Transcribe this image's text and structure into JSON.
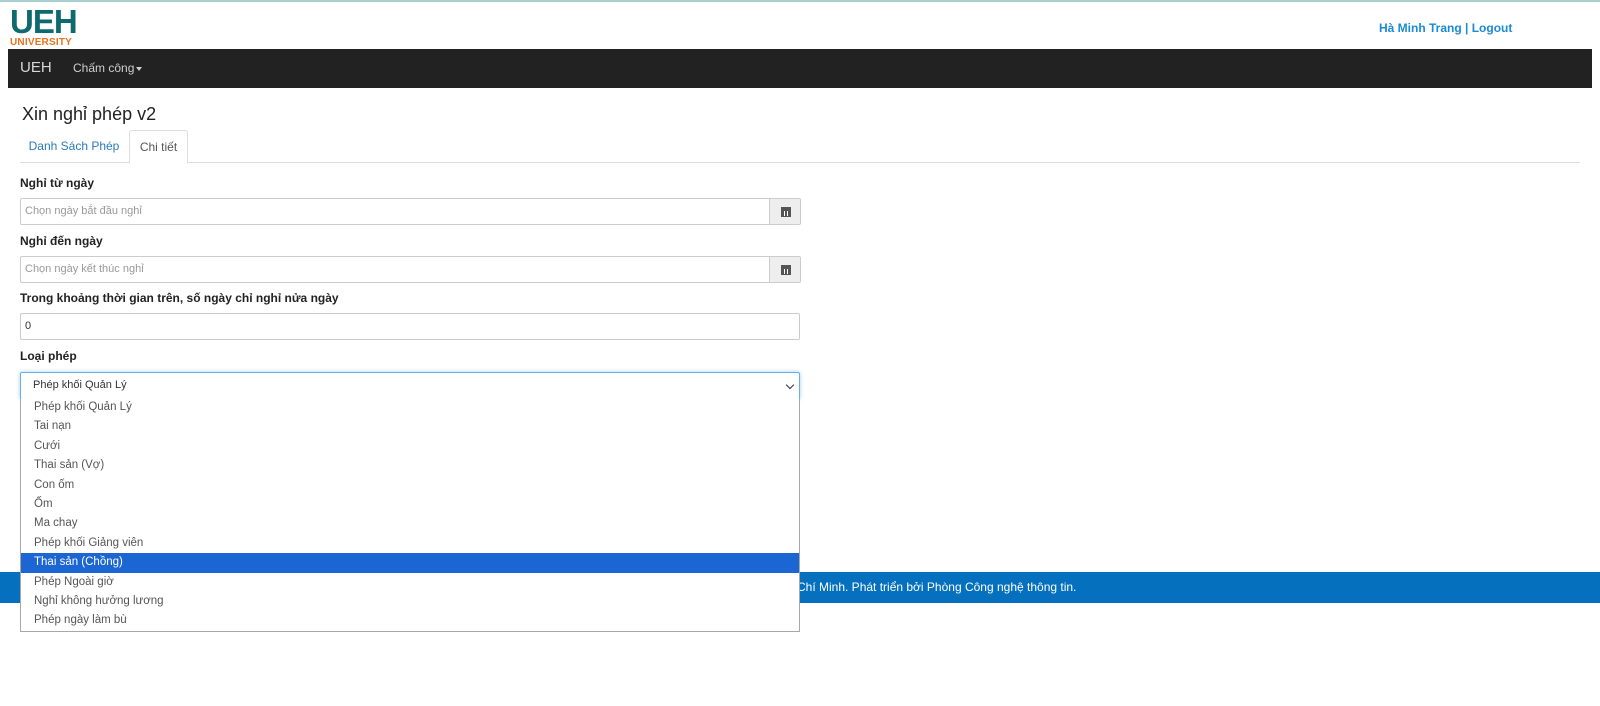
{
  "header": {
    "logo_main": "UEH",
    "logo_sub": "UNIVERSITY",
    "user_name": "Hà Minh Trang",
    "separator": " | ",
    "logout": "Logout"
  },
  "navbar": {
    "brand": "UEH",
    "menu_label": "Chấm công"
  },
  "page": {
    "title": "Xin nghỉ phép v2"
  },
  "tabs": [
    {
      "label": "Danh Sách Phép"
    },
    {
      "label": "Chi tiết"
    }
  ],
  "form": {
    "from_date_label": "Nghỉ từ ngày",
    "from_date_placeholder": "Chọn ngày bắt đầu nghỉ",
    "to_date_label": "Nghỉ đến ngày",
    "to_date_placeholder": "Chọn ngày kết thúc nghỉ",
    "half_day_label": "Trong khoảng thời gian trên, số ngày chỉ nghỉ nửa ngày",
    "half_day_value": "0",
    "leave_type_label": "Loại phép",
    "leave_type_value": "Phép khối Quản Lý"
  },
  "dropdown": {
    "options": [
      "Phép khối Quản Lý",
      "Tai nạn",
      "Cưới",
      "Thai sản (Vợ)",
      "Con ốm",
      "Ốm",
      "Ma chay",
      "Phép khối Giảng viên",
      "Thai sản (Chồng)",
      "Phép Ngoài giờ",
      "Nghỉ không hưởng lương",
      "Phép ngày làm bù"
    ],
    "highlighted": "Thai sản (Chồng)"
  },
  "footer": {
    "text": "Chí Minh. Phát triển bởi Phòng Công nghệ thông tin."
  },
  "colors": {
    "navbar": "#222222",
    "footer": "#0570bd",
    "highlight": "#1c66d3",
    "link": "#1a8ad4"
  }
}
